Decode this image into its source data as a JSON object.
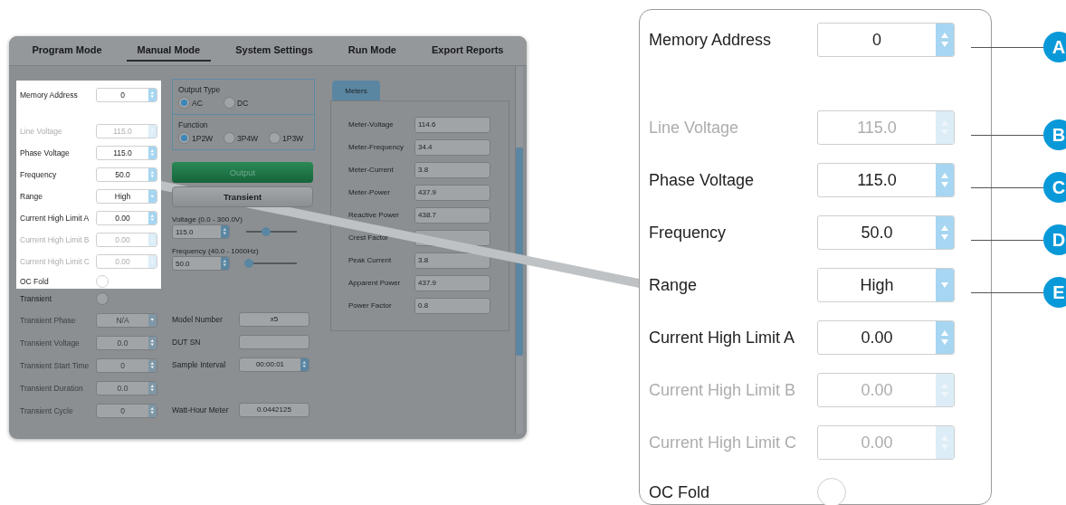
{
  "screenshot": {
    "tabs": [
      {
        "label": "Program Mode",
        "selected": false
      },
      {
        "label": "Manual Mode",
        "selected": true
      },
      {
        "label": "System Settings",
        "selected": false
      },
      {
        "label": "Run Mode",
        "selected": false
      },
      {
        "label": "Export Reports",
        "selected": false
      }
    ],
    "highlighted_settings": [
      {
        "label": "Memory Address",
        "value": "0",
        "kind": "spin",
        "disabled": false
      },
      {
        "label": "Line Voltage",
        "value": "115.0",
        "kind": "spin",
        "disabled": true
      },
      {
        "label": "Phase Voltage",
        "value": "115.0",
        "kind": "spin",
        "disabled": false
      },
      {
        "label": "Frequency",
        "value": "50.0",
        "kind": "spin",
        "disabled": false
      },
      {
        "label": "Range",
        "value": "High",
        "kind": "select",
        "disabled": false
      },
      {
        "label": "Current High Limit A",
        "value": "0.00",
        "kind": "spin",
        "disabled": false
      },
      {
        "label": "Current High Limit B",
        "value": "0.00",
        "kind": "spin",
        "disabled": true
      },
      {
        "label": "Current High Limit C",
        "value": "0.00",
        "kind": "spin",
        "disabled": true
      },
      {
        "label": "OC Fold",
        "kind": "radio",
        "checked": false,
        "disabled": false
      }
    ],
    "settings": [
      {
        "label": "Transient",
        "kind": "radio",
        "checked": false,
        "disabled": false
      },
      {
        "label": "Transient Phase",
        "value": "N/A",
        "kind": "select",
        "disabled": true
      },
      {
        "label": "Transient Voltage",
        "value": "0.0",
        "kind": "spin",
        "disabled": true
      },
      {
        "label": "Transient Start Time",
        "value": "0",
        "kind": "spin",
        "disabled": true
      },
      {
        "label": "Transient Duration",
        "value": "0.0",
        "kind": "spin",
        "disabled": true
      },
      {
        "label": "Transient Cycle",
        "value": "0",
        "kind": "spin",
        "disabled": true
      }
    ],
    "output_type": {
      "title": "Output Type",
      "options": [
        {
          "label": "AC",
          "selected": true
        },
        {
          "label": "DC",
          "selected": false
        }
      ]
    },
    "function": {
      "title": "Function",
      "options": [
        {
          "label": "1P2W",
          "selected": true
        },
        {
          "label": "3P4W",
          "selected": false
        },
        {
          "label": "1P3W",
          "selected": false
        }
      ]
    },
    "buttons": [
      {
        "label": "Output",
        "kind": "primary"
      },
      {
        "label": "Transient",
        "kind": "secondary"
      }
    ],
    "controls": [
      {
        "label": "Voltage (0.0 - 300.0V)",
        "value": "115.0",
        "level": 0.4
      },
      {
        "label": "Frequency (40.0 - 1000Hz)",
        "value": "50.0",
        "level": 0.05
      }
    ],
    "info": [
      {
        "label": "Model Number",
        "value": "x5",
        "kind": "text"
      },
      {
        "label": "DUT SN",
        "kind": "text"
      },
      {
        "label": "Sample Interval",
        "value": "00:00:01",
        "kind": "spin"
      },
      {
        "label": "Watt-Hour Meter",
        "value": "0.0442125",
        "kind": "text"
      }
    ],
    "meters": {
      "tab": "Meters",
      "rows": [
        {
          "label": "Meter-Voltage",
          "value": "114.6"
        },
        {
          "label": "Meter-Frequency",
          "value": "34.4"
        },
        {
          "label": "Meter-Current",
          "value": "3.8"
        },
        {
          "label": "Meter-Power",
          "value": "437.9"
        },
        {
          "label": "Reactive Power",
          "value": "438.7"
        },
        {
          "label": "Crest Factor"
        },
        {
          "label": "Peak Current",
          "value": "3.8"
        },
        {
          "label": "Apparent Power",
          "value": "437.9"
        },
        {
          "label": "Power Factor",
          "value": "0.8"
        }
      ]
    }
  },
  "zoom": {
    "fields": [
      {
        "label": "Memory Address",
        "value": "0",
        "kind": "spin",
        "disabled": false,
        "callout": "A"
      },
      {
        "label": "Line Voltage",
        "value": "115.0",
        "kind": "spin",
        "disabled": true,
        "callout": "B"
      },
      {
        "label": "Phase Voltage",
        "value": "115.0",
        "kind": "spin",
        "disabled": false,
        "callout": "C"
      },
      {
        "label": "Frequency",
        "value": "50.0",
        "kind": "spin",
        "disabled": false,
        "callout": "D"
      },
      {
        "label": "Range",
        "value": "High",
        "kind": "select",
        "disabled": false,
        "callout": "E"
      },
      {
        "label": "Current High Limit A",
        "value": "0.00",
        "kind": "spin",
        "disabled": false
      },
      {
        "label": "Current High Limit B",
        "value": "0.00",
        "kind": "spin",
        "disabled": true
      },
      {
        "label": "Current High Limit C",
        "value": "0.00",
        "kind": "spin",
        "disabled": true
      },
      {
        "label": "OC Fold",
        "kind": "radio",
        "checked": false,
        "disabled": false
      }
    ]
  }
}
